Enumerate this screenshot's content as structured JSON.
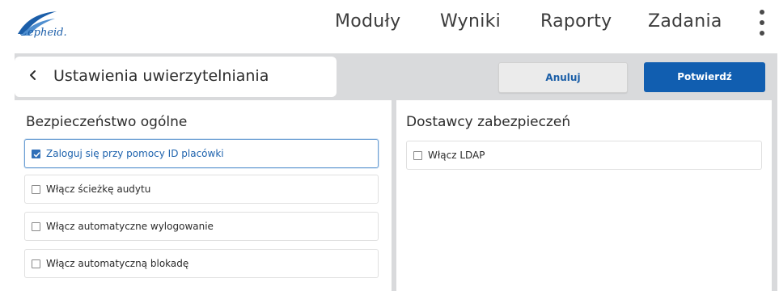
{
  "brand": {
    "name": "Cepheid."
  },
  "nav": {
    "items": [
      {
        "label": "Moduły"
      },
      {
        "label": "Wyniki"
      },
      {
        "label": "Raporty"
      },
      {
        "label": "Zadania"
      }
    ],
    "menu_icon": "kebab-menu-icon"
  },
  "header": {
    "back_icon": "chevron-left-icon",
    "title": "Ustawienia uwierzytelniania",
    "cancel_label": "Anuluj",
    "confirm_label": "Potwierdź"
  },
  "left_panel": {
    "heading": "Bezpieczeństwo ogólne",
    "options": [
      {
        "label": "Zaloguj się przy pomocy ID placówki",
        "checked": true
      },
      {
        "label": "Włącz ścieżkę audytu",
        "checked": false
      },
      {
        "label": "Włącz automatyczne wylogowanie",
        "checked": false
      },
      {
        "label": "Włącz automatyczną blokadę",
        "checked": false
      }
    ]
  },
  "right_panel": {
    "heading": "Dostawcy zabezpieczeń",
    "options": [
      {
        "label": "Włącz LDAP",
        "checked": false
      }
    ]
  },
  "colors": {
    "accent": "#115eb0",
    "background": "#d9dadc",
    "surface": "#ffffff",
    "checked": "#2f6fb8"
  }
}
